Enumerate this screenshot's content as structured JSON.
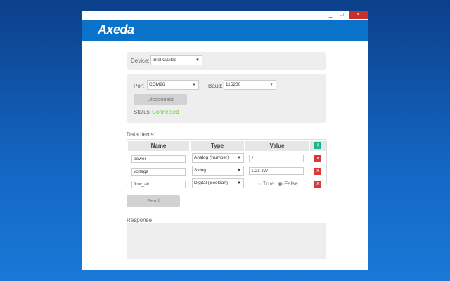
{
  "window": {
    "minimize": "_",
    "maximize": "□",
    "close": "×"
  },
  "brand": "Axeda",
  "device": {
    "label": "Device:",
    "value": "Intel Galileo"
  },
  "connection": {
    "port_label": "Port",
    "port_value": "COM26",
    "baud_label": "Baud:",
    "baud_value": "115200",
    "disconnect": "Disconnect",
    "status_label": "Status:",
    "status_value": "Connected",
    "status_color": "#6ccf3a"
  },
  "data_items": {
    "title": "Data Items:",
    "headers": [
      "Name",
      "Type",
      "Value"
    ],
    "add": "+",
    "rows": [
      {
        "name": "power",
        "type": "Analog (Number)",
        "value": "2"
      },
      {
        "name": "voltage",
        "type": "String",
        "value": "1.21 JW"
      },
      {
        "name": "flow_air",
        "type": "Digital (Boolean)",
        "true_label": "True",
        "false_label": "False"
      }
    ],
    "delete": "x"
  },
  "send": "Send",
  "response": {
    "title": "Response"
  }
}
